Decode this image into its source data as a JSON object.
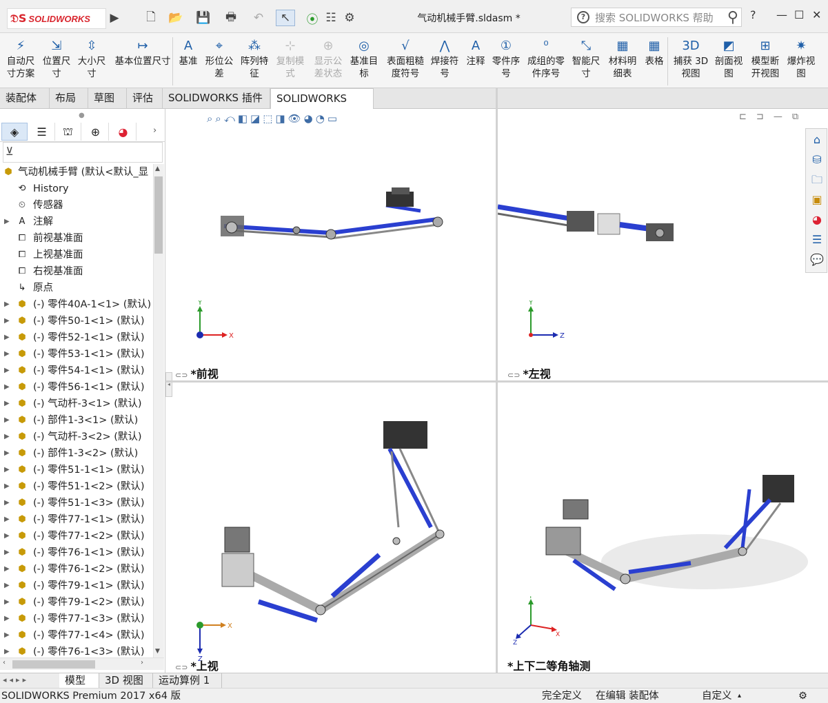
{
  "app": {
    "logo_text": "SOLIDWORKS",
    "document_title": "气动机械手臂.sldasm *",
    "search_placeholder": "搜索 SOLIDWORKS 帮助"
  },
  "toolbar": {
    "items": [
      {
        "label": "自动尺寸方案",
        "icon": "auto-dimension-icon",
        "enabled": true
      },
      {
        "label": "位置尺寸",
        "icon": "location-dimension-icon",
        "enabled": true
      },
      {
        "label": "大小尺寸",
        "icon": "size-dimension-icon",
        "enabled": true
      },
      {
        "label": "基本位置尺寸",
        "icon": "basic-location-dimension-icon",
        "enabled": true
      },
      {
        "label": "基准",
        "icon": "datum-icon",
        "enabled": true
      },
      {
        "label": "形位公差",
        "icon": "geometric-tolerance-icon",
        "enabled": true
      },
      {
        "label": "阵列特征",
        "icon": "pattern-feature-icon",
        "enabled": true
      },
      {
        "label": "复制模式",
        "icon": "copy-scheme-icon",
        "enabled": false
      },
      {
        "label": "显示公差状态",
        "icon": "show-tolerance-status-icon",
        "enabled": false
      },
      {
        "label": "基准目标",
        "icon": "datum-target-icon",
        "enabled": true
      },
      {
        "label": "表面粗糙度符号",
        "icon": "surface-finish-icon",
        "enabled": true
      },
      {
        "label": "焊接符号",
        "icon": "weld-symbol-icon",
        "enabled": true
      },
      {
        "label": "注释",
        "icon": "note-icon",
        "enabled": true
      },
      {
        "label": "零件序号",
        "icon": "balloon-icon",
        "enabled": true
      },
      {
        "label": "成组的零件序号",
        "icon": "stacked-balloon-icon",
        "enabled": true
      },
      {
        "label": "智能尺寸",
        "icon": "smart-dimension-icon",
        "enabled": true
      },
      {
        "label": "材料明细表",
        "icon": "bom-icon",
        "enabled": true
      },
      {
        "label": "表格",
        "icon": "table-icon",
        "enabled": true
      },
      {
        "label": "捕获 3D 视图",
        "icon": "capture-3d-view-icon",
        "enabled": true
      },
      {
        "label": "剖面视图",
        "icon": "section-view-icon",
        "enabled": true
      },
      {
        "label": "模型断开视图",
        "icon": "model-break-view-icon",
        "enabled": true
      },
      {
        "label": "爆炸视图",
        "icon": "exploded-view-icon",
        "enabled": true
      }
    ]
  },
  "tabs": [
    "装配体",
    "布局",
    "草图",
    "评估",
    "SOLIDWORKS 插件",
    "SOLIDWORKS MBD"
  ],
  "active_tab": "SOLIDWORKS MBD",
  "tree": {
    "root": "气动机械手臂 (默认<默认_显",
    "items": [
      {
        "label": "History",
        "icon": "history-icon",
        "expandable": false
      },
      {
        "label": "传感器",
        "icon": "sensor-icon",
        "expandable": false
      },
      {
        "label": "注解",
        "icon": "annotations-icon",
        "expandable": true
      },
      {
        "label": "前视基准面",
        "icon": "plane-icon",
        "expandable": false
      },
      {
        "label": "上视基准面",
        "icon": "plane-icon",
        "expandable": false
      },
      {
        "label": "右视基准面",
        "icon": "plane-icon",
        "expandable": false
      },
      {
        "label": "原点",
        "icon": "origin-icon",
        "expandable": false
      },
      {
        "label": "(-) 零件40A-1<1> (默认)",
        "icon": "part-icon",
        "expandable": true
      },
      {
        "label": "(-) 零件50-1<1> (默认)",
        "icon": "part-icon",
        "expandable": true
      },
      {
        "label": "(-) 零件52-1<1> (默认)",
        "icon": "part-icon",
        "expandable": true
      },
      {
        "label": "(-) 零件53-1<1> (默认)",
        "icon": "part-icon",
        "expandable": true
      },
      {
        "label": "(-) 零件54-1<1> (默认)",
        "icon": "part-icon",
        "expandable": true
      },
      {
        "label": "(-) 零件56-1<1> (默认)",
        "icon": "part-icon",
        "expandable": true
      },
      {
        "label": "(-) 气动杆-3<1> (默认)",
        "icon": "part-icon",
        "expandable": true
      },
      {
        "label": "(-) 部件1-3<1> (默认)",
        "icon": "part-icon",
        "expandable": true
      },
      {
        "label": "(-) 气动杆-3<2> (默认)",
        "icon": "part-icon",
        "expandable": true
      },
      {
        "label": "(-) 部件1-3<2> (默认)",
        "icon": "part-icon",
        "expandable": true
      },
      {
        "label": "(-) 零件51-1<1> (默认)",
        "icon": "part-icon",
        "expandable": true
      },
      {
        "label": "(-) 零件51-1<2> (默认)",
        "icon": "part-icon",
        "expandable": true
      },
      {
        "label": "(-) 零件51-1<3> (默认)",
        "icon": "part-icon",
        "expandable": true
      },
      {
        "label": "(-) 零件77-1<1> (默认)",
        "icon": "part-icon",
        "expandable": true
      },
      {
        "label": "(-) 零件77-1<2> (默认)",
        "icon": "part-icon",
        "expandable": true
      },
      {
        "label": "(-) 零件76-1<1> (默认)",
        "icon": "part-icon",
        "expandable": true
      },
      {
        "label": "(-) 零件76-1<2> (默认)",
        "icon": "part-icon",
        "expandable": true
      },
      {
        "label": "(-) 零件79-1<1> (默认)",
        "icon": "part-icon",
        "expandable": true
      },
      {
        "label": "(-) 零件79-1<2> (默认)",
        "icon": "part-icon",
        "expandable": true
      },
      {
        "label": "(-) 零件77-1<3> (默认)",
        "icon": "part-icon",
        "expandable": true
      },
      {
        "label": "(-) 零件77-1<4> (默认)",
        "icon": "part-icon",
        "expandable": true
      },
      {
        "label": "(-) 零件76-1<3> (默认)",
        "icon": "part-icon",
        "expandable": true
      }
    ]
  },
  "viewports": {
    "front": {
      "label": "*前视",
      "axis_h": "X",
      "axis_v": "Y"
    },
    "left": {
      "label": "*左视",
      "axis_h": "Z",
      "axis_v": "Y"
    },
    "top": {
      "label": "*上视",
      "axis_h": "X",
      "axis_v": "Z"
    },
    "iso": {
      "label": "*上下二等角轴测",
      "axis_h": "X",
      "axis_v": "Y",
      "axis_d": "Z"
    }
  },
  "bottom_tabs": [
    "模型",
    "3D 视图",
    "运动算例 1"
  ],
  "active_bottom_tab": "模型",
  "status": {
    "product": "SOLIDWORKS Premium 2017 x64 版",
    "definition": "完全定义",
    "mode": "在编辑 装配体",
    "units": "自定义"
  },
  "colors": {
    "accent": "#1f5fa8",
    "brand": "#d9262e",
    "arm_blue": "#2a3fd0"
  }
}
